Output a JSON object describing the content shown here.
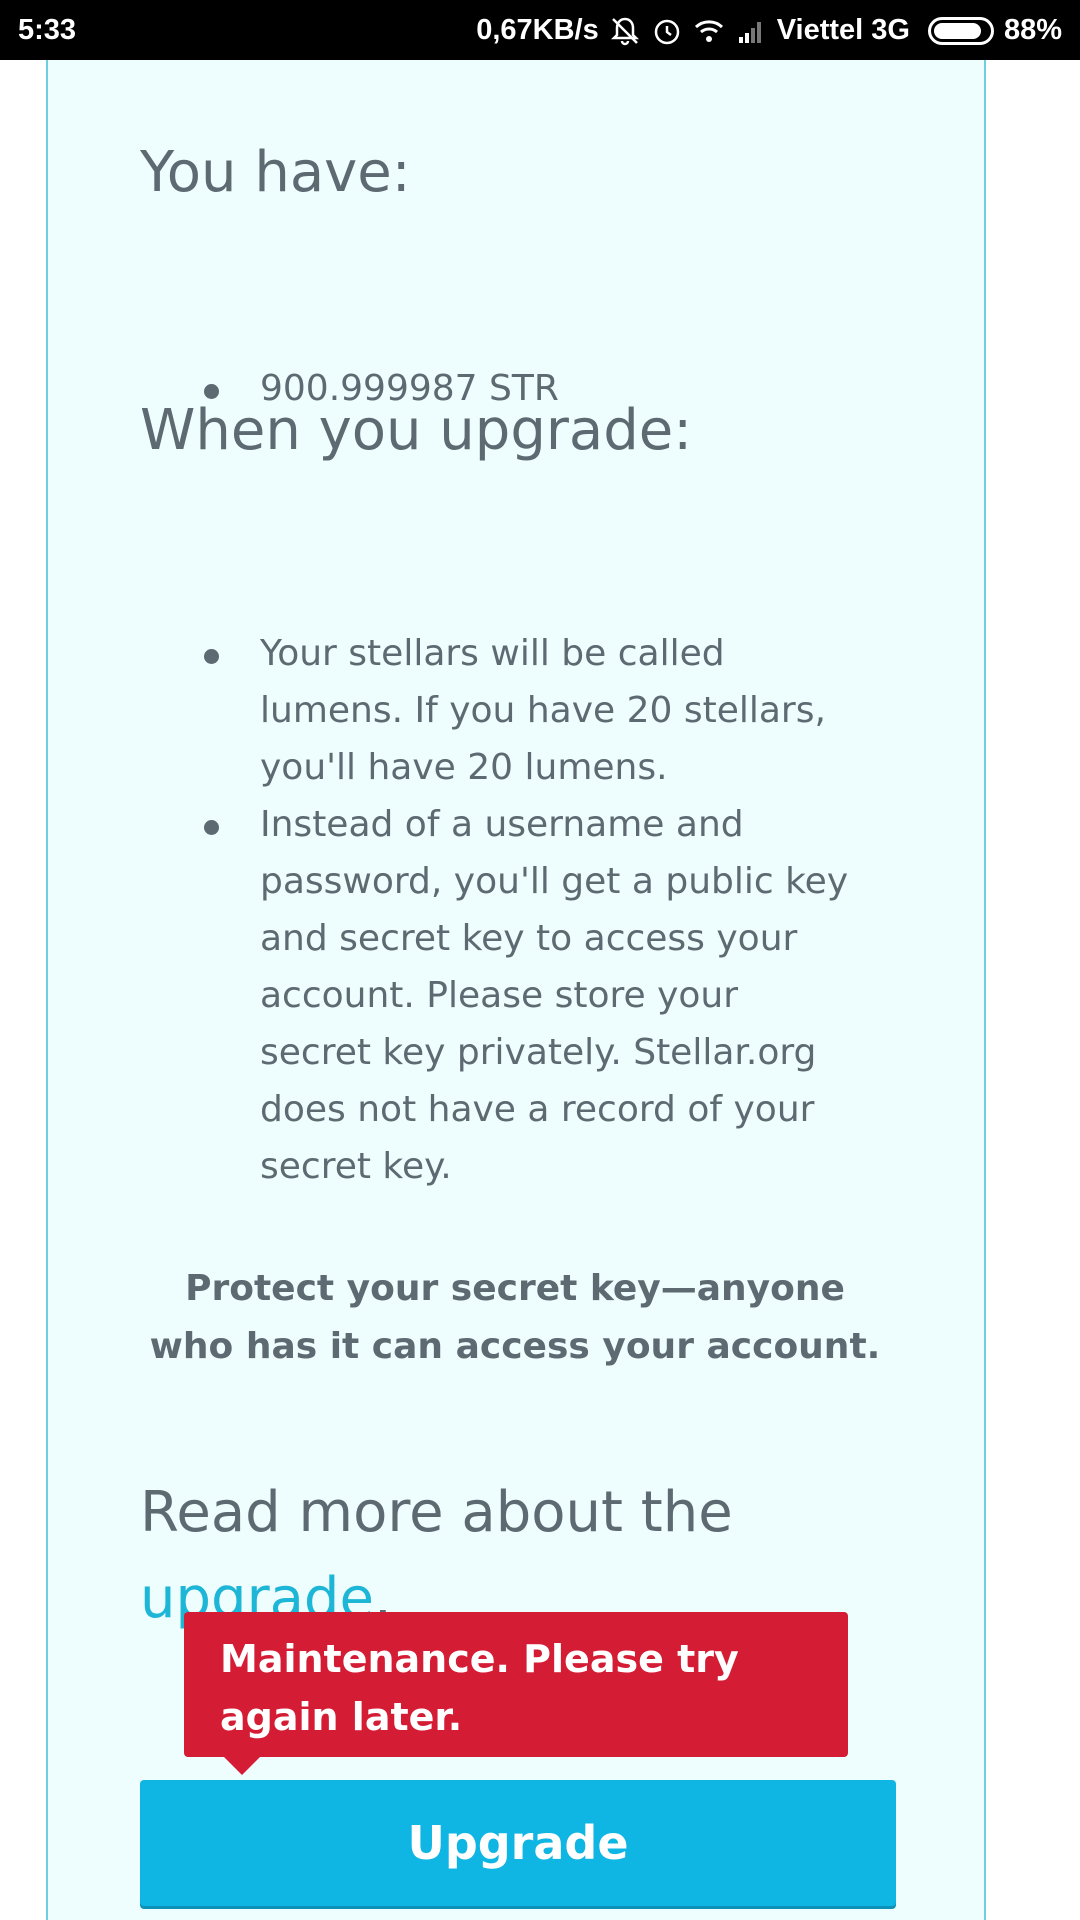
{
  "status_bar": {
    "time": "5:33",
    "network_speed": "0,67KB/s",
    "carrier": "Viettel 3G",
    "battery": "88%",
    "battery_level": 0.88
  },
  "headings": {
    "you_have": "You have:",
    "when_upgrade": "When you upgrade:"
  },
  "balances": [
    "900.999987 STR"
  ],
  "upgrade_points": [
    "Your stellars will be called lumens. If you have 20 stellars, you'll have 20 lumens.",
    "Instead of a username and password, you'll get a public key and secret key to access your account. Please store your secret key privately. Stellar.org does not have a record of your secret key."
  ],
  "warning": "Protect your secret key—anyone who has it can access your account.",
  "read_more": {
    "prefix": "Read more about the ",
    "link": "upgrade",
    "suffix": "."
  },
  "error_message": "Maintenance. Please try again later.",
  "upgrade_button": "Upgrade",
  "colors": {
    "panel_bg": "#eefdfd",
    "text": "#5e6a72",
    "link": "#1eb6d6",
    "error": "#d41c35",
    "button": "#0fb5e3"
  }
}
